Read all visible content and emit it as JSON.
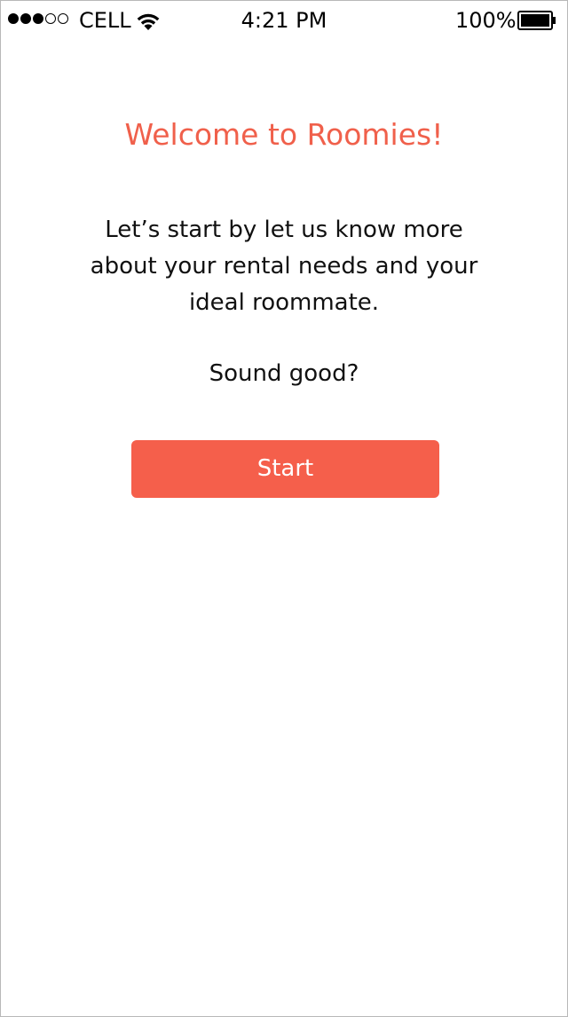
{
  "status_bar": {
    "carrier": "CELL",
    "time": "4:21 PM",
    "battery_percent": "100%",
    "signal_strength": 3,
    "signal_max": 5,
    "wifi_icon": "wifi-icon",
    "battery_icon": "battery-icon",
    "battery_level": 1.0
  },
  "welcome": {
    "title": "Welcome to Roomies!",
    "message": "Let’s start by let us know more about your rental needs and your ideal roommate.",
    "question": "Sound good?",
    "start_label": "Start"
  },
  "colors": {
    "accent": "#f55f4b",
    "title": "#f0604b"
  }
}
